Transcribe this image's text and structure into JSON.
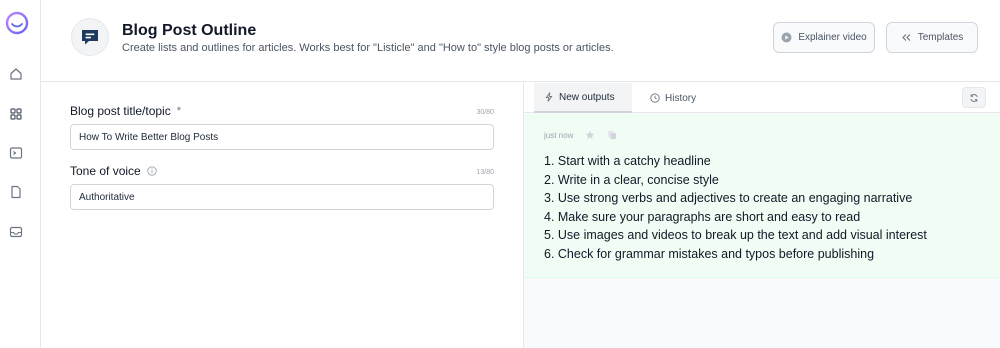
{
  "sidebar": {
    "icons": [
      "logo-icon",
      "home-icon",
      "apps-grid-icon",
      "terminal-icon",
      "document-icon",
      "inbox-icon"
    ]
  },
  "header": {
    "title": "Blog Post Outline",
    "subtitle": "Create lists and outlines for articles. Works best for \"Listicle\" and \"How to\" style blog posts or articles.",
    "explainer_label": "Explainer video",
    "templates_label": "Templates"
  },
  "form": {
    "title_field": {
      "label": "Blog post title/topic",
      "required_mark": "*",
      "counter": "30/80",
      "value": "How To Write Better Blog Posts"
    },
    "tone_field": {
      "label": "Tone of voice",
      "counter": "13/80",
      "value": "Authoritative"
    }
  },
  "output": {
    "tabs": [
      {
        "label": "New outputs",
        "active": true
      },
      {
        "label": "History",
        "active": false
      }
    ],
    "timestamp": "just now",
    "items": [
      "1. Start with a catchy headline",
      "2. Write in a clear, concise style",
      "3. Use strong verbs and adjectives to create an engaging narrative",
      "4. Make sure your paragraphs are short and easy to read",
      "5. Use images and videos to break up the text and add visual interest",
      "6. Check for grammar mistakes and typos before publishing"
    ]
  },
  "colors": {
    "accent": "#1e3a5f",
    "output_bg": "#f0fdf4",
    "border": "#e5e7eb"
  }
}
